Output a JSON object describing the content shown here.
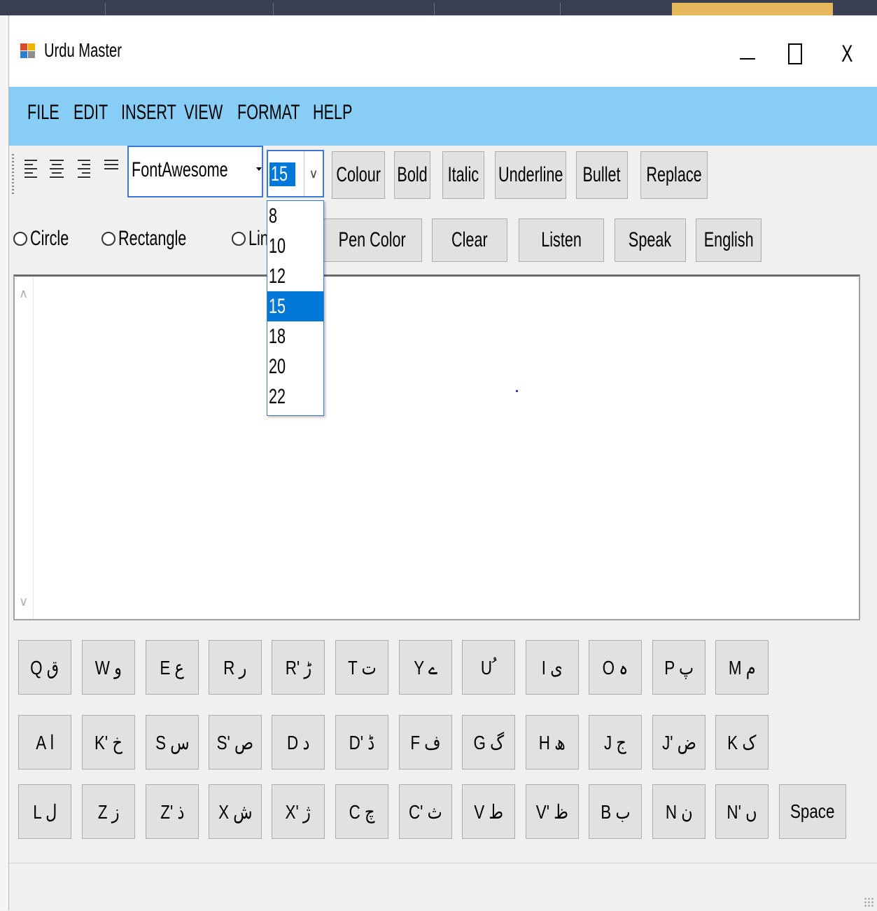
{
  "window": {
    "title": "Urdu Master",
    "close_symbol": "X"
  },
  "menu": [
    "FILE",
    "EDIT",
    "INSERT",
    "VIEW",
    "FORMAT",
    "HELP"
  ],
  "toolbar": {
    "align_icons": [
      "align-left-icon",
      "align-center-icon",
      "align-right-icon",
      "align-justify-icon"
    ],
    "font_name": "FontAwesome",
    "font_size": "15",
    "buttons": [
      "Colour",
      "Bold",
      "Italic",
      "Underline",
      "Bullet",
      "Replace"
    ]
  },
  "font_size_dropdown": {
    "options": [
      "8",
      "10",
      "12",
      "15",
      "18",
      "20",
      "22"
    ],
    "selected": "15"
  },
  "shapes": {
    "radios": [
      "Circle",
      "Rectangle",
      "Lin"
    ],
    "buttons": [
      "Pen Color",
      "Clear",
      "Listen",
      "Speak",
      "English"
    ]
  },
  "keyboard": {
    "row1": [
      "Q ق",
      "W و",
      "E ع",
      "R ر",
      "R' ڑ",
      "T ت",
      "Y ے",
      "U ُ",
      "I ی",
      "O ہ",
      "P پ",
      "M م"
    ],
    "row2": [
      "A ا",
      "K' خ",
      "S س",
      "S' ص",
      "D د",
      "D' ڈ",
      "F ف",
      "G گ",
      "H ھ",
      "J ج",
      "J' ض",
      "K ک"
    ],
    "row3": [
      "L ل",
      "Z ز",
      "Z' ذ",
      "X ش",
      "X' ژ",
      "C چ",
      "C' ث",
      "V ط",
      "V' ظ",
      "B ب",
      "N ن",
      "N' ں",
      "Space"
    ]
  },
  "colors": {
    "menubar": "#87cdf5",
    "selection": "#0078d7",
    "button_face": "#e1e1e1"
  }
}
